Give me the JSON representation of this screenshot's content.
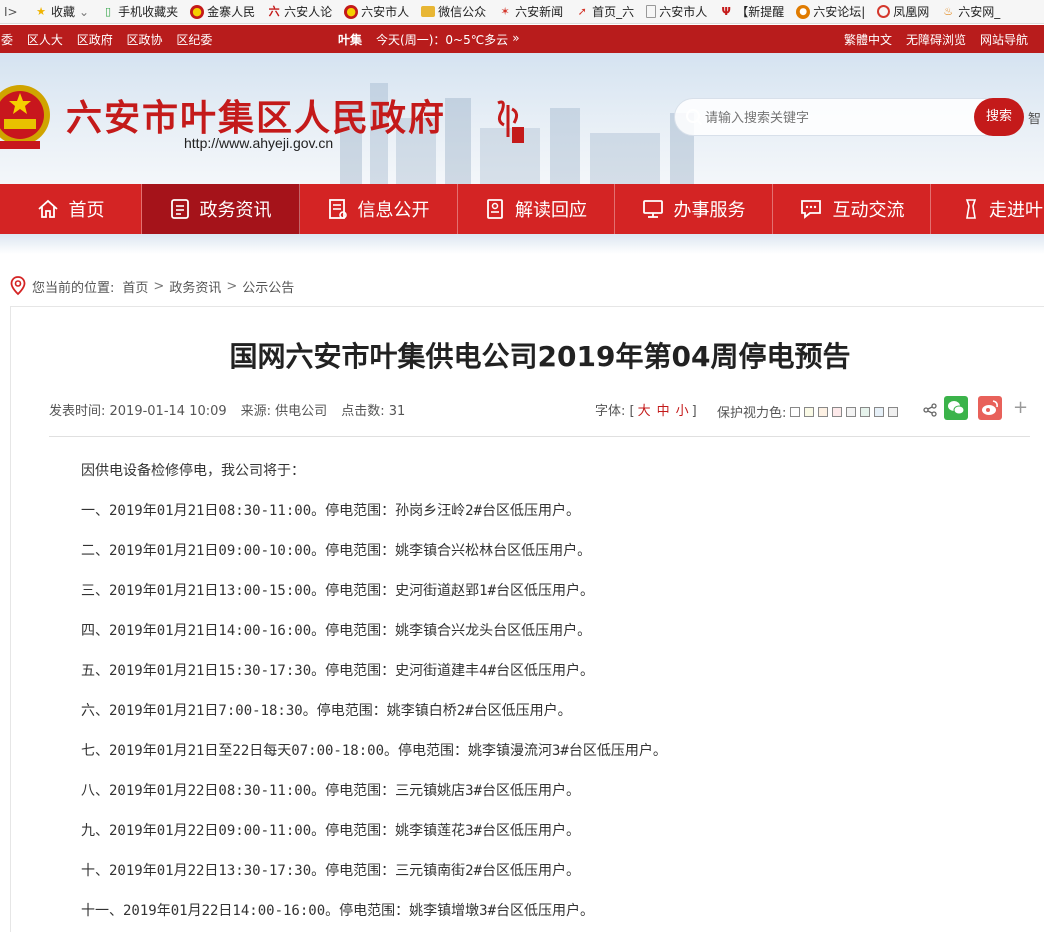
{
  "bookmarks": {
    "toggle": "I>",
    "items": [
      {
        "label": "收藏",
        "icon": "star-icon",
        "color": "#f0b400"
      },
      {
        "label": "手机收藏夹",
        "icon": "phone-icon",
        "color": "#36a54a"
      },
      {
        "label": "金寨人民",
        "icon": "emblem-icon",
        "color": "#c41a1a"
      },
      {
        "label": "六安人论",
        "icon": "site-icon",
        "color": "#c41a1a"
      },
      {
        "label": "六安市人",
        "icon": "emblem-icon",
        "color": "#c41a1a"
      },
      {
        "label": "微信公众",
        "icon": "folder-icon",
        "color": "#e8b634"
      },
      {
        "label": "六安新闻",
        "icon": "site-icon",
        "color": "#d4372c"
      },
      {
        "label": "首页_六",
        "icon": "site-icon",
        "color": "#d4372c"
      },
      {
        "label": "六安市人",
        "icon": "page-icon",
        "color": "#888888"
      },
      {
        "label": "【新提醒",
        "icon": "site-icon",
        "color": "#c41a1a"
      },
      {
        "label": "六安论坛|",
        "icon": "site-icon",
        "color": "#e07b00"
      },
      {
        "label": "凤凰网",
        "icon": "phoenix-icon",
        "color": "#d4372c"
      },
      {
        "label": "六安网_",
        "icon": "site-icon",
        "color": "#e07b00"
      }
    ]
  },
  "topbar": {
    "left_links": [
      "委",
      "区人大",
      "区政府",
      "区政协",
      "区纪委"
    ],
    "location": "叶集",
    "weather": "今天(周一)：0~5℃多云",
    "right_links": [
      "繁體中文",
      "无障碍浏览",
      "网站导航"
    ]
  },
  "header": {
    "title": "六安市叶集区人民政府",
    "url": "http://www.ahyeji.gov.cn",
    "search_placeholder": "请输入搜索关键字",
    "search_button": "搜索",
    "smart": "智"
  },
  "nav": {
    "items": [
      {
        "label": "首页",
        "icon": "home-icon"
      },
      {
        "label": "政务资讯",
        "icon": "news-icon",
        "active": true
      },
      {
        "label": "信息公开",
        "icon": "document-icon"
      },
      {
        "label": "解读回应",
        "icon": "interpret-icon"
      },
      {
        "label": "办事服务",
        "icon": "monitor-icon"
      },
      {
        "label": "互动交流",
        "icon": "chat-icon"
      },
      {
        "label": "走进叶",
        "icon": "walk-icon"
      }
    ]
  },
  "breadcrumb": {
    "prefix": "您当前的位置:",
    "items": [
      "首页",
      "政务资讯",
      "公示公告"
    ],
    "separator": ">"
  },
  "article": {
    "title": "国网六安市叶集供电公司2019年第04周停电预告",
    "publish_time": "发表时间: 2019-01-14 10:09",
    "source": "来源: 供电公司",
    "clicks": "点击数: 31",
    "font_label": "字体: [",
    "font_large": "大",
    "font_medium": "中",
    "font_small": "小",
    "font_close": "]",
    "eyecare_label": "保护视力色:",
    "eyecare_colors": [
      "#ffffff",
      "#fafae6",
      "#fdf1e4",
      "#fde9ea",
      "#f3f3f3",
      "#e6f3ec",
      "#e6f0f8",
      "#f0f0f0"
    ],
    "plus": "+",
    "paragraphs": [
      "因供电设备检修停电，我公司将于：",
      "一、2019年01月21日08:30-11:00。停电范围：孙岗乡汪岭2#台区低压用户。",
      "二、2019年01月21日09:00-10:00。停电范围：姚李镇合兴松林台区低压用户。",
      "三、2019年01月21日13:00-15:00。停电范围：史河街道赵郢1#台区低压用户。",
      "四、2019年01月21日14:00-16:00。停电范围：姚李镇合兴龙头台区低压用户。",
      "五、2019年01月21日15:30-17:30。停电范围：史河街道建丰4#台区低压用户。",
      "六、2019年01月21日7:00-18:30。停电范围：姚李镇白桥2#台区低压用户。",
      "七、2019年01月21日至22日每天07:00-18:00。停电范围：姚李镇漫流河3#台区低压用户。",
      "八、2019年01月22日08:30-11:00。停电范围：三元镇姚店3#台区低压用户。",
      "九、2019年01月22日09:00-11:00。停电范围：姚李镇莲花3#台区低压用户。",
      "十、2019年01月22日13:30-17:30。停电范围：三元镇南街2#台区低压用户。",
      "十一、2019年01月22日14:00-16:00。停电范围：姚李镇增墩3#台区低压用户。"
    ]
  },
  "colors": {
    "brand_red": "#c41a1a",
    "nav_red": "#d42424",
    "nav_active": "#a5131a"
  }
}
